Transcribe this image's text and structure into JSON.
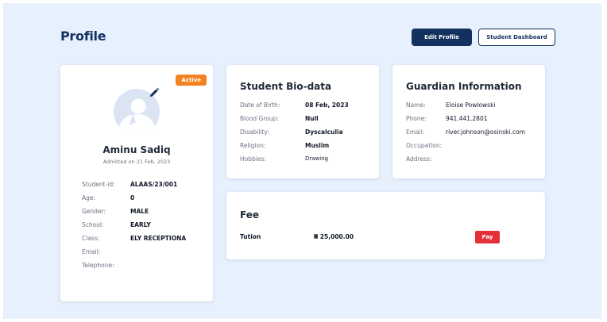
{
  "header": {
    "title": "Profile",
    "edit_profile_label": "Edit Profile",
    "student_dashboard_label": "Student Dashboard"
  },
  "student": {
    "status": "Active",
    "name": "Aminu Sadiq",
    "admitted": "Admitted on 21 Feb, 2023",
    "fields": [
      {
        "label": "Student-id:",
        "value": "ALAAS/23/001"
      },
      {
        "label": "Age:",
        "value": "0"
      },
      {
        "label": "Gender:",
        "value": "MALE"
      },
      {
        "label": "School:",
        "value": "EARLY"
      },
      {
        "label": "Class:",
        "value": "ELY RECEPTIONA"
      },
      {
        "label": "Email:",
        "value": ""
      },
      {
        "label": "Telephone:",
        "value": ""
      }
    ]
  },
  "biodata": {
    "title": "Student Bio-data",
    "fields": [
      {
        "label": "Date of Birth:",
        "value": "08 Feb, 2023"
      },
      {
        "label": "Blood Group:",
        "value": "Null"
      },
      {
        "label": "Disability:",
        "value": "Dyscalculia"
      },
      {
        "label": "Religion:",
        "value": "Muslim"
      },
      {
        "label": "Hobbies:",
        "value": "Drawing"
      }
    ]
  },
  "guardian": {
    "title": "Guardian Information",
    "fields": [
      {
        "label": "Name:",
        "value": "Eloise Powlowski"
      },
      {
        "label": "Phone:",
        "value": "941.441.2801"
      },
      {
        "label": "Email:",
        "value": "river.johnson@osinski.com"
      },
      {
        "label": "Occupation:",
        "value": ""
      },
      {
        "label": "Address:",
        "value": ""
      }
    ]
  },
  "fee": {
    "title": "Fee",
    "item_label": "Tution",
    "amount": "₦ 25,000.00",
    "pay_label": "Pay"
  },
  "colors": {
    "primary": "#12315f",
    "background": "#e7f0fd",
    "active_badge": "#f58220",
    "pay_button": "#e5303a"
  }
}
